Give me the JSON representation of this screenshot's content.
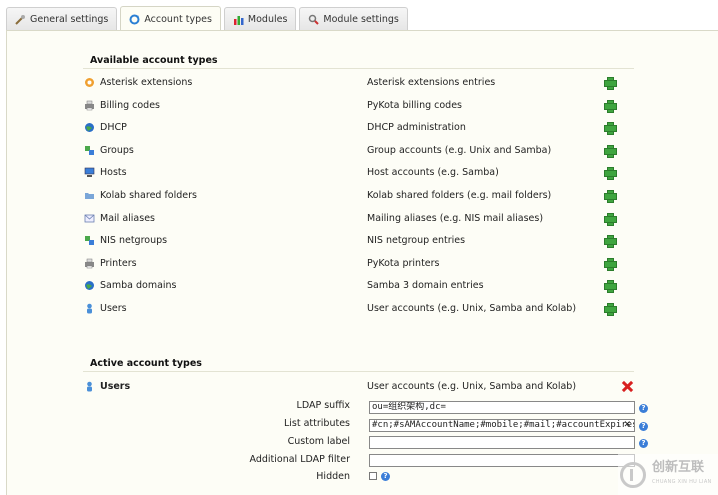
{
  "tabs": [
    {
      "label": "General settings",
      "icon": "tools-icon",
      "active": false
    },
    {
      "label": "Account types",
      "icon": "refresh-icon",
      "active": true
    },
    {
      "label": "Modules",
      "icon": "chart-icon",
      "active": false
    },
    {
      "label": "Module settings",
      "icon": "search-gear-icon",
      "active": false
    }
  ],
  "available": {
    "heading": "Available account types",
    "items": [
      {
        "name": "Asterisk extensions",
        "desc": "Asterisk extensions entries",
        "icon": "asterisk-icon"
      },
      {
        "name": "Billing codes",
        "desc": "PyKota billing codes",
        "icon": "printer-icon"
      },
      {
        "name": "DHCP",
        "desc": "DHCP administration",
        "icon": "globe-icon"
      },
      {
        "name": "Groups",
        "desc": "Group accounts (e.g. Unix and Samba)",
        "icon": "group-icon"
      },
      {
        "name": "Hosts",
        "desc": "Host accounts (e.g. Samba)",
        "icon": "computer-icon"
      },
      {
        "name": "Kolab shared folders",
        "desc": "Kolab shared folders (e.g. mail folders)",
        "icon": "folder-icon"
      },
      {
        "name": "Mail aliases",
        "desc": "Mailing aliases (e.g. NIS mail aliases)",
        "icon": "mail-icon"
      },
      {
        "name": "NIS netgroups",
        "desc": "NIS netgroup entries",
        "icon": "group-icon"
      },
      {
        "name": "Printers",
        "desc": "PyKota printers",
        "icon": "printer-icon"
      },
      {
        "name": "Samba domains",
        "desc": "Samba 3 domain entries",
        "icon": "globe-icon"
      },
      {
        "name": "Users",
        "desc": "User accounts (e.g. Unix, Samba and Kolab)",
        "icon": "user-icon"
      }
    ]
  },
  "active": {
    "heading": "Active account types",
    "item": {
      "name": "Users",
      "desc": "User accounts (e.g. Unix, Samba and Kolab)",
      "icon": "user-icon"
    },
    "fields": {
      "ldap_suffix_label": "LDAP suffix",
      "ldap_suffix_value": "ou=组织架构,dc=",
      "list_attributes_label": "List attributes",
      "list_attributes_value": "#cn;#sAMAccountName;#mobile;#mail;#accountExpires",
      "custom_label_label": "Custom label",
      "custom_label_value": "",
      "additional_filter_label": "Additional LDAP filter",
      "additional_filter_value": "",
      "hidden_label": "Hidden"
    }
  },
  "watermark": {
    "title": "创新互联",
    "subtitle": "CHUANG XIN HU LIAN"
  },
  "colors": {
    "panel": "#fdfdf6",
    "add": "#3fa53f",
    "delete": "#d82020",
    "help": "#3b7ed8"
  }
}
